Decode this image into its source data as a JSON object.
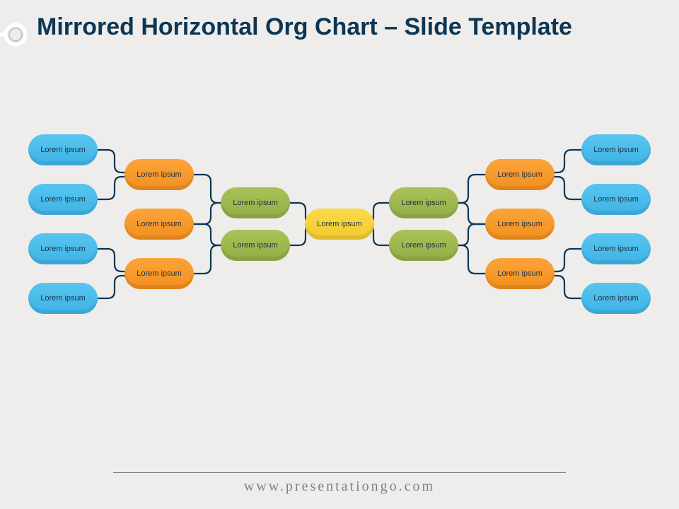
{
  "title": "Mirrored Horizontal Org Chart – Slide Template",
  "footer": "www.presentationgo.com",
  "center": "Lorem ipsum",
  "left": {
    "green": [
      "Lorem ipsum",
      "Lorem ipsum"
    ],
    "orange": [
      "Lorem ipsum",
      "Lorem ipsum",
      "Lorem ipsum"
    ],
    "blue": [
      "Lorem ipsum",
      "Lorem ipsum",
      "Lorem ipsum",
      "Lorem ipsum"
    ]
  },
  "right": {
    "green": [
      "Lorem ipsum",
      "Lorem ipsum"
    ],
    "orange": [
      "Lorem ipsum",
      "Lorem ipsum",
      "Lorem ipsum"
    ],
    "blue": [
      "Lorem ipsum",
      "Lorem ipsum",
      "Lorem ipsum",
      "Lorem ipsum"
    ]
  }
}
